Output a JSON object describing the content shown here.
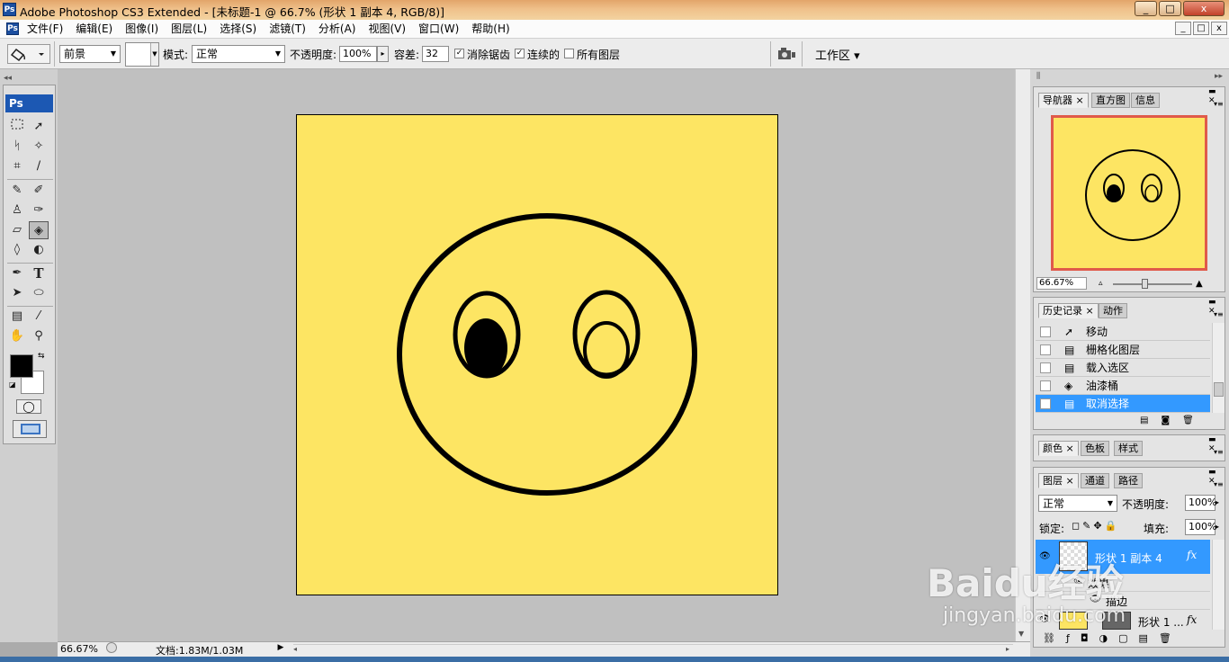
{
  "window": {
    "title": "Adobe Photoshop CS3 Extended - [未标题-1 @ 66.7% (形状 1 副本 4, RGB/8)]",
    "app_icon": "Ps",
    "controls": [
      "_",
      "□",
      "x"
    ]
  },
  "menubar": {
    "items": [
      "文件(F)",
      "编辑(E)",
      "图像(I)",
      "图层(L)",
      "选择(S)",
      "滤镜(T)",
      "分析(A)",
      "视图(V)",
      "窗口(W)",
      "帮助(H)"
    ],
    "doc_controls": [
      "_",
      "□",
      "x"
    ]
  },
  "options": {
    "fill_source": "前景",
    "mode_label": "模式:",
    "mode_value": "正常",
    "opacity_label": "不透明度:",
    "opacity_value": "100%",
    "tolerance_label": "容差:",
    "tolerance_value": "32",
    "antialias_label": "消除锯齿",
    "antialias_checked": true,
    "contiguous_label": "连续的",
    "contiguous_checked": true,
    "all_layers_label": "所有图层",
    "all_layers_checked": false,
    "workspace_label": "工作区 ▾"
  },
  "toolbox": {
    "header": "Ps",
    "foreground_color": "#000000",
    "background_color": "#ffffff"
  },
  "canvas": {
    "background_color": "#fde563",
    "stroke_color": "#000000"
  },
  "status": {
    "zoom": "66.67%",
    "doc_info": "文档:1.83M/1.03M"
  },
  "navigator": {
    "tabs": [
      "导航器",
      "直方图",
      "信息"
    ],
    "zoom": "66.67%",
    "frame_color": "#e05a4a"
  },
  "history": {
    "tabs": [
      "历史记录",
      "动作"
    ],
    "items": [
      {
        "icon": "move-icon",
        "label": "移动",
        "selected": false
      },
      {
        "icon": "document-icon",
        "label": "栅格化图层",
        "selected": false
      },
      {
        "icon": "document-icon",
        "label": "载入选区",
        "selected": false
      },
      {
        "icon": "paint-bucket-icon",
        "label": "油漆桶",
        "selected": false
      },
      {
        "icon": "document-icon",
        "label": "取消选择",
        "selected": true
      }
    ]
  },
  "color_panel": {
    "tabs": [
      "颜色",
      "色板",
      "样式"
    ]
  },
  "layers": {
    "tabs": [
      "图层",
      "通道",
      "路径"
    ],
    "blend_mode": "正常",
    "opacity_label": "不透明度:",
    "opacity_value": "100%",
    "lock_label": "锁定:",
    "fill_label": "填充:",
    "fill_value": "100%",
    "items": [
      {
        "name": "形状 1 副本 4",
        "selected": true,
        "fx": "fx"
      },
      {
        "name": "效果",
        "sub": true
      },
      {
        "name": "描边",
        "sub": true
      },
      {
        "name": "形状 1 ...",
        "fx": "fx"
      }
    ]
  },
  "watermark": {
    "brand": "Baidu经验",
    "url": "jingyan.baidu.com"
  }
}
